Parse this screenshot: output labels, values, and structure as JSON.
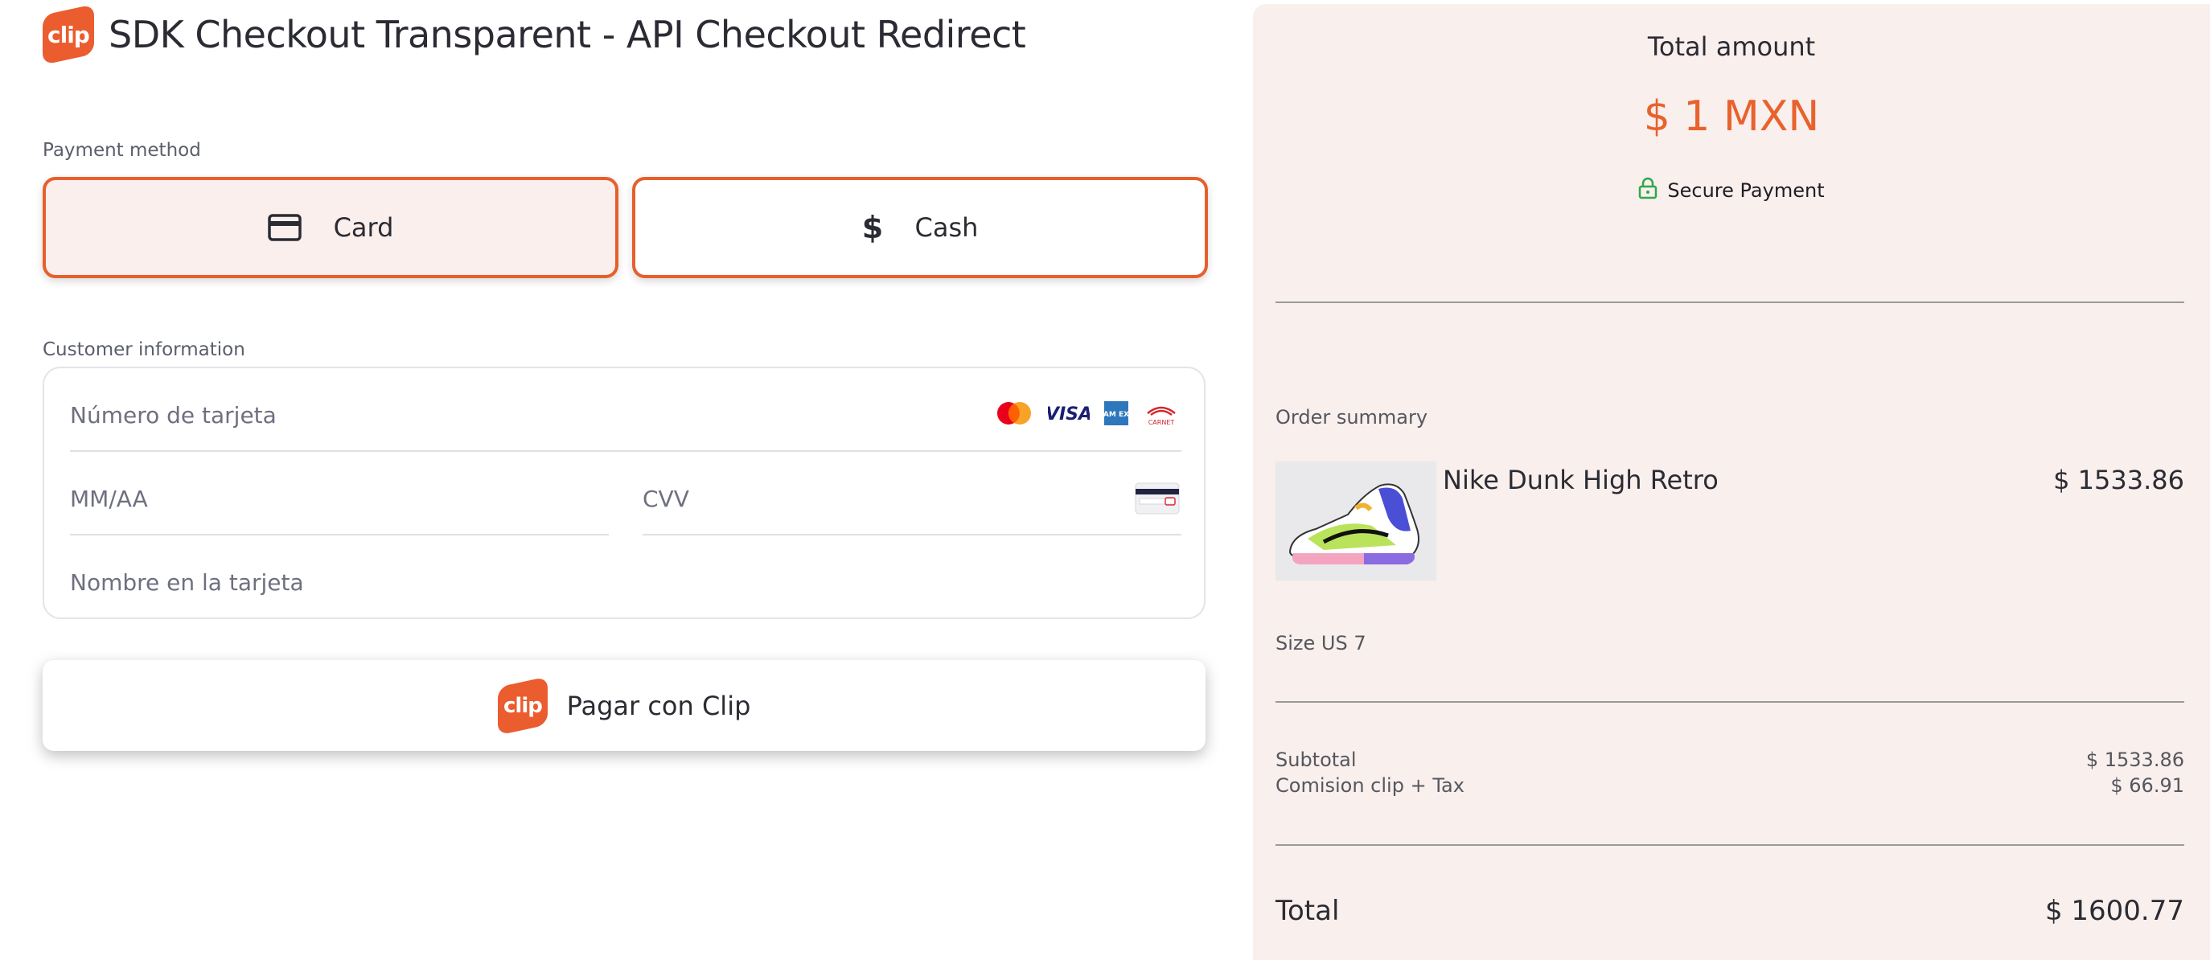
{
  "header": {
    "logo_text": "clip",
    "title": "SDK Checkout Transparent - API Checkout Redirect"
  },
  "payment_method": {
    "label": "Payment method",
    "options": [
      {
        "label": "Card",
        "icon": "credit-card-icon",
        "selected": true
      },
      {
        "label": "Cash",
        "icon": "dollar-icon",
        "selected": false
      }
    ]
  },
  "customer_info": {
    "label": "Customer information",
    "card_number_placeholder": "Número de tarjeta",
    "expiry_placeholder": "MM/AA",
    "cvv_placeholder": "CVV",
    "name_placeholder": "Nombre en la tarjeta",
    "card_brands": [
      "mastercard-icon",
      "visa-icon",
      "amex-icon",
      "carnet-icon"
    ],
    "visa_text": "VISA",
    "amex_text": "AM EX",
    "carnet_text": "CARNET"
  },
  "pay_button": {
    "logo_text": "clip",
    "label": "Pagar con Clip"
  },
  "summary": {
    "total_amount_label": "Total amount",
    "total_amount_value": "$ 1 MXN",
    "secure_label": "Secure Payment",
    "order_summary_label": "Order summary",
    "product": {
      "name": "Nike Dunk High Retro",
      "price": "$ 1533.86",
      "size": "Size US 7"
    },
    "subtotal_label": "Subtotal",
    "subtotal_value": "$ 1533.86",
    "fee_label": "Comision clip + Tax",
    "fee_value": "$ 66.91",
    "total_label": "Total",
    "total_value": "$ 1600.77"
  },
  "colors": {
    "accent": "#e8622e",
    "panel_bg": "#f9efec",
    "secure_green": "#2ea84a"
  }
}
